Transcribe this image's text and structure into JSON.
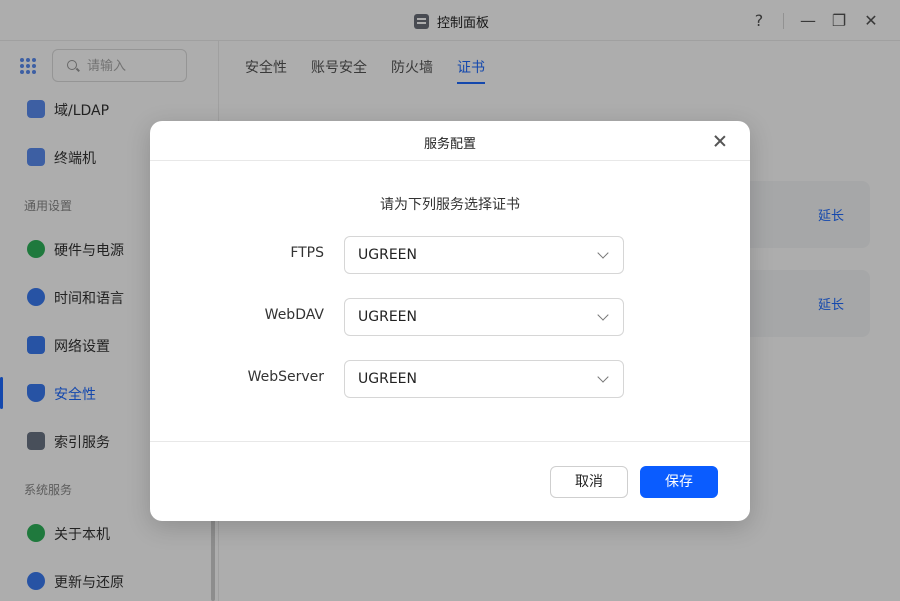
{
  "window": {
    "title": "控制面板",
    "help": "?",
    "minimize": "—",
    "maximize": "❐",
    "close": "✕"
  },
  "sidebar": {
    "search_placeholder": "请输入",
    "items": [
      {
        "label": "域/LDAP",
        "icon": "directory-icon",
        "color": "#5b8df0"
      },
      {
        "label": "终端机",
        "icon": "terminal-icon",
        "color": "#5b8df0"
      },
      {
        "label": "硬件与电源",
        "icon": "hardware-icon",
        "color": "#2fb35a"
      },
      {
        "label": "时间和语言",
        "icon": "clock-icon",
        "color": "#3a7bf2"
      },
      {
        "label": "网络设置",
        "icon": "network-icon",
        "color": "#3a7bf2"
      },
      {
        "label": "安全性",
        "icon": "shield-icon",
        "color": "#3a7bf2"
      },
      {
        "label": "索引服务",
        "icon": "index-icon",
        "color": "#6b7585"
      },
      {
        "label": "关于本机",
        "icon": "info-icon",
        "color": "#2fb35a"
      },
      {
        "label": "更新与还原",
        "icon": "refresh-icon",
        "color": "#3a7bf2"
      }
    ],
    "groups": [
      "通用设置",
      "系统服务"
    ]
  },
  "main": {
    "tabs": [
      {
        "label": "安全性"
      },
      {
        "label": "账号安全"
      },
      {
        "label": "防火墙"
      },
      {
        "label": "证书"
      }
    ],
    "cards": [
      {
        "action": "延长"
      },
      {
        "action": "延长"
      }
    ]
  },
  "dialog": {
    "title": "服务配置",
    "subtitle": "请为下列服务选择证书",
    "fields": [
      {
        "label": "FTPS",
        "value": "UGREEN"
      },
      {
        "label": "WebDAV",
        "value": "UGREEN"
      },
      {
        "label": "WebServer",
        "value": "UGREEN"
      }
    ],
    "cancel_label": "取消",
    "save_label": "保存"
  },
  "colors": {
    "accent": "#1e6bff",
    "primary_button": "#0a5cff"
  }
}
